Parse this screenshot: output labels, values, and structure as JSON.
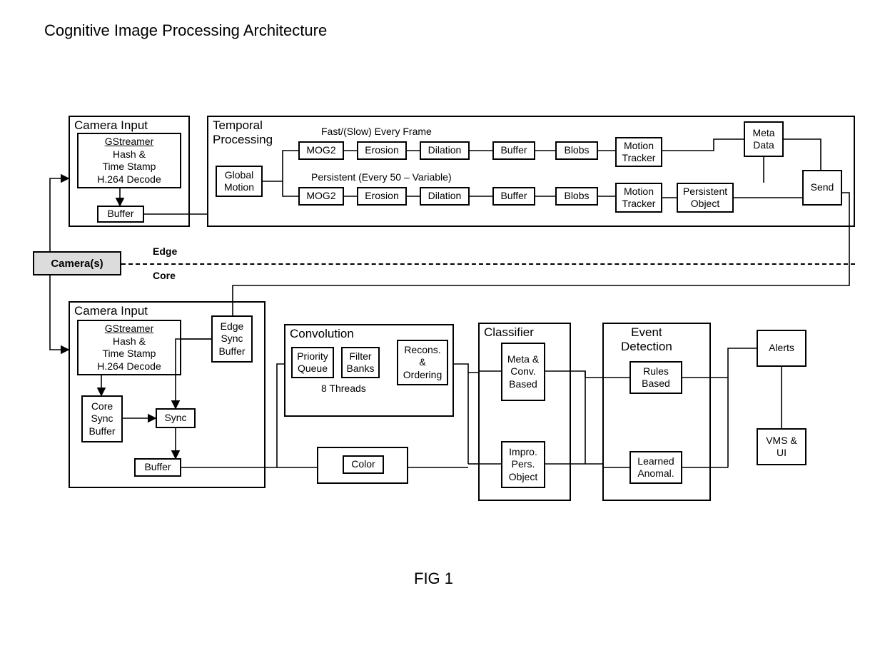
{
  "title": "Cognitive Image Processing Architecture",
  "figure_label": "FIG 1",
  "cameras": "Camera(s)",
  "divider": {
    "edge": "Edge",
    "core": "Core"
  },
  "edge": {
    "camera_input": {
      "title": "Camera Input",
      "gstreamer": "GStreamer",
      "gstreamer_body": "Hash &\nTime Stamp\nH.264 Decode",
      "buffer": "Buffer"
    },
    "temporal": {
      "title": "Temporal\nProcessing",
      "fast_label": "Fast/(Slow) Every Frame",
      "persistent_label": "Persistent (Every 50 – Variable)",
      "global_motion": "Global\nMotion",
      "mog2": "MOG2",
      "erosion": "Erosion",
      "dilation": "Dilation",
      "buffer": "Buffer",
      "blobs": "Blobs",
      "motion_tracker": "Motion\nTracker",
      "meta_data": "Meta\nData",
      "persistent_object": "Persistent\nObject",
      "send": "Send"
    }
  },
  "core": {
    "camera_input": {
      "title": "Camera Input",
      "gstreamer": "GStreamer",
      "gstreamer_body": "Hash &\nTime Stamp\nH.264 Decode",
      "edge_sync_buffer": "Edge\nSync\nBuffer",
      "core_sync_buffer": "Core\nSync\nBuffer",
      "sync": "Sync",
      "buffer": "Buffer"
    },
    "convolution": {
      "title": "Convolution",
      "priority_queue": "Priority\nQueue",
      "filter_banks": "Filter\nBanks",
      "recons_ordering": "Recons.\n&\nOrdering",
      "threads": "8 Threads",
      "color": "Color"
    },
    "classifier": {
      "title": "Classifier",
      "meta_conv": "Meta\n&\nConv.\nBased",
      "impro_pers": "Impro.\nPers.\nObject"
    },
    "event_detection": {
      "title": "Event\nDetection",
      "rules_based": "Rules\nBased",
      "learned_anomal": "Learned\nAnomal."
    },
    "outputs": {
      "alerts": "Alerts",
      "vms_ui": "VMS &\nUI"
    }
  }
}
